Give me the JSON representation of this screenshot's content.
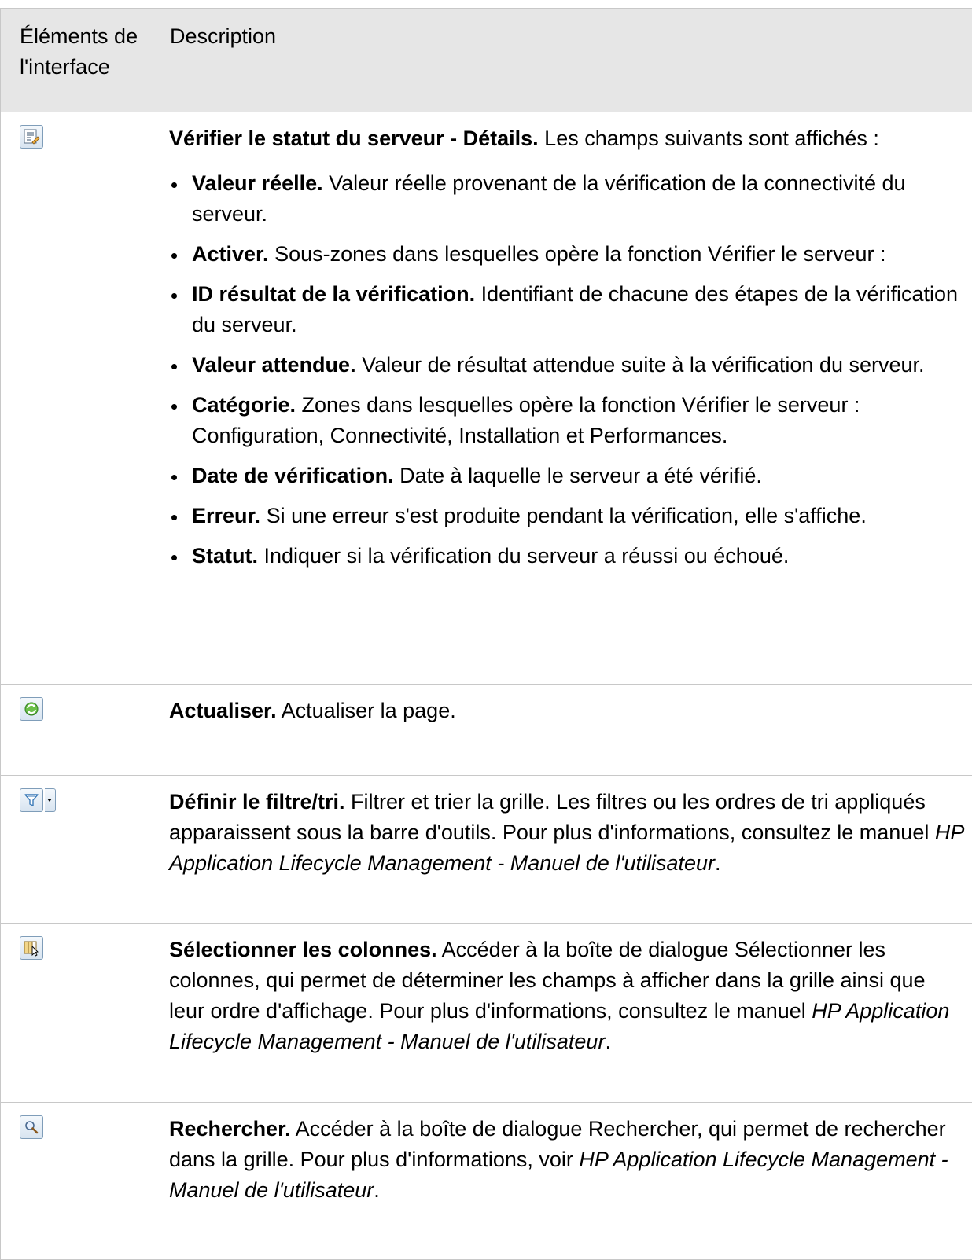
{
  "header": {
    "col1_label": "Éléments de l'interface",
    "col2_label": "Description"
  },
  "rows": [
    {
      "icon": "details-icon",
      "title": "Vérifier le statut du serveur - Détails.",
      "text": " Les champs suivants sont affichés :",
      "items": [
        {
          "term": "Valeur réelle.",
          "text": " Valeur réelle provenant de la vérification de la connectivité du serveur."
        },
        {
          "term": "Activer.",
          "text": " Sous-zones dans lesquelles opère la fonction Vérifier le serveur :"
        },
        {
          "term": "ID résultat de la vérification.",
          "text": " Identifiant de chacune des étapes de la vérification du serveur."
        },
        {
          "term": "Valeur attendue.",
          "text": " Valeur de résultat attendue suite à la vérification du serveur."
        },
        {
          "term": "Catégorie.",
          "text": " Zones dans lesquelles opère la fonction Vérifier le serveur : Configuration, Connectivité, Installation et Performances."
        },
        {
          "term": "Date de vérification.",
          "text": " Date à laquelle le serveur a été vérifié."
        },
        {
          "term": "Erreur.",
          "text": " Si une erreur s'est produite pendant la vérification, elle s'affiche."
        },
        {
          "term": "Statut.",
          "text": " Indiquer si la vérification du serveur a réussi ou échoué."
        }
      ]
    },
    {
      "icon": "refresh-icon",
      "title": "Actualiser.",
      "text": " Actualiser la page."
    },
    {
      "icon": "filter-icon",
      "title": "Définir le filtre/tri.",
      "text": " Filtrer et trier la grille. Les filtres ou les ordres de tri appliqués apparaissent sous la barre d'outils. Pour plus d'informations, consultez le manuel ",
      "italic": "HP Application Lifecycle Management - Manuel de l'utilisateur",
      "suffix": "."
    },
    {
      "icon": "select-columns-icon",
      "title": "Sélectionner les colonnes.",
      "text": " Accéder à la boîte de dialogue Sélectionner les colonnes, qui permet de déterminer les champs à afficher dans la grille ainsi que leur ordre d'affichage. Pour plus d'informations, consultez le manuel ",
      "italic": "HP Application Lifecycle Management - Manuel de l'utilisateur",
      "suffix": "."
    },
    {
      "icon": "search-icon",
      "title": "Rechercher.",
      "text": " Accéder à la boîte de dialogue Rechercher, qui permet de rechercher dans la grille. Pour plus d'informations, voir ",
      "italic": "HP Application Lifecycle Management - Manuel de l'utilisateur",
      "suffix": "."
    }
  ]
}
